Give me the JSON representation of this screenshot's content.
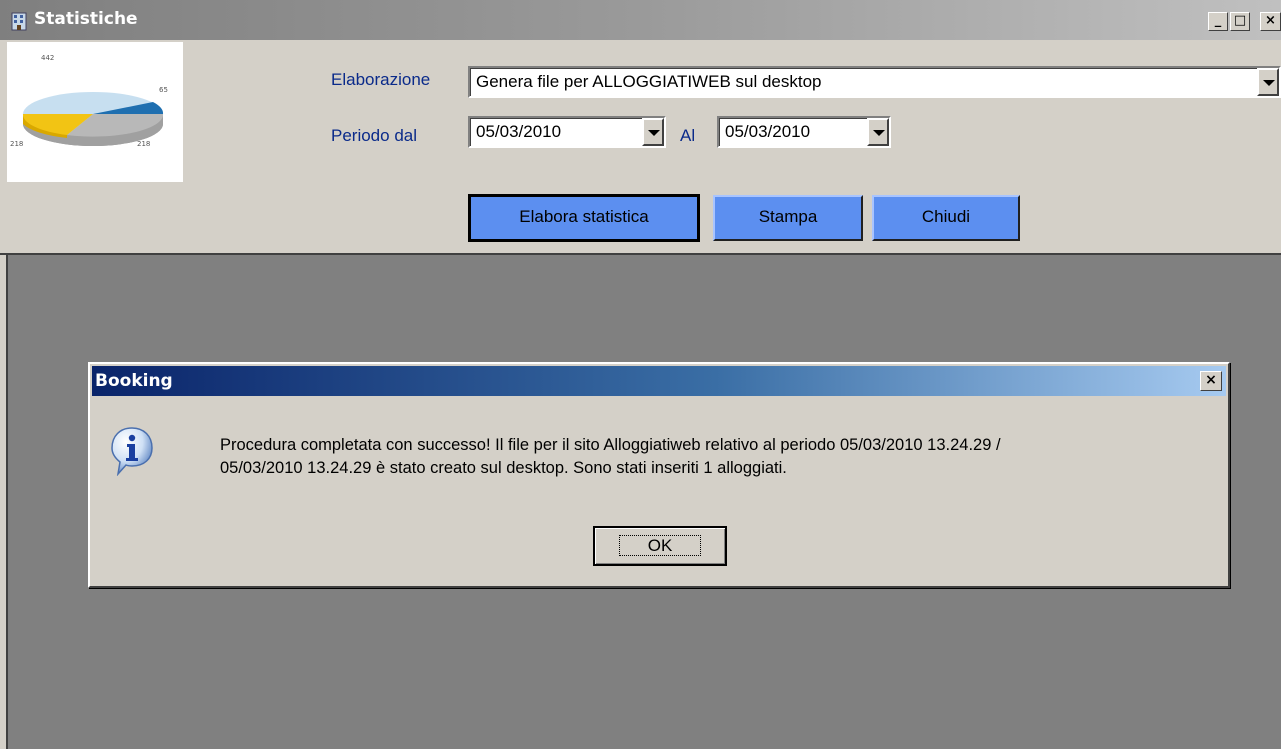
{
  "window": {
    "title": "Statistiche",
    "controls": [
      "_",
      "□",
      "×"
    ]
  },
  "form": {
    "elaborazione_label": "Elaborazione",
    "elaborazione_value": "Genera file per ALLOGGIATIWEB sul desktop",
    "periodo_label": "Periodo dal",
    "date_from": "05/03/2010",
    "al_label": "Al",
    "date_to": "05/03/2010"
  },
  "logo_chart": {
    "labels": [
      "442",
      "65",
      "218",
      "218"
    ]
  },
  "buttons": {
    "elabora": "Elabora statistica",
    "stampa": "Stampa",
    "chiudi": "Chiudi"
  },
  "dialog": {
    "title": "Booking",
    "close": "×",
    "message_line1": "Procedura completata con successo! Il file per il sito Alloggiatiweb relativo al periodo 05/03/2010 13.24.29 /",
    "message_line2": "05/03/2010 13.24.29 è stato creato sul desktop. Sono stati inseriti 1 alloggiati.",
    "ok": "OK"
  },
  "colors": {
    "button_blue": "#5c8ff0",
    "label_blue": "#0a2a8a",
    "dialog_title_start": "#0a246a",
    "dialog_title_end": "#a6caf0"
  }
}
